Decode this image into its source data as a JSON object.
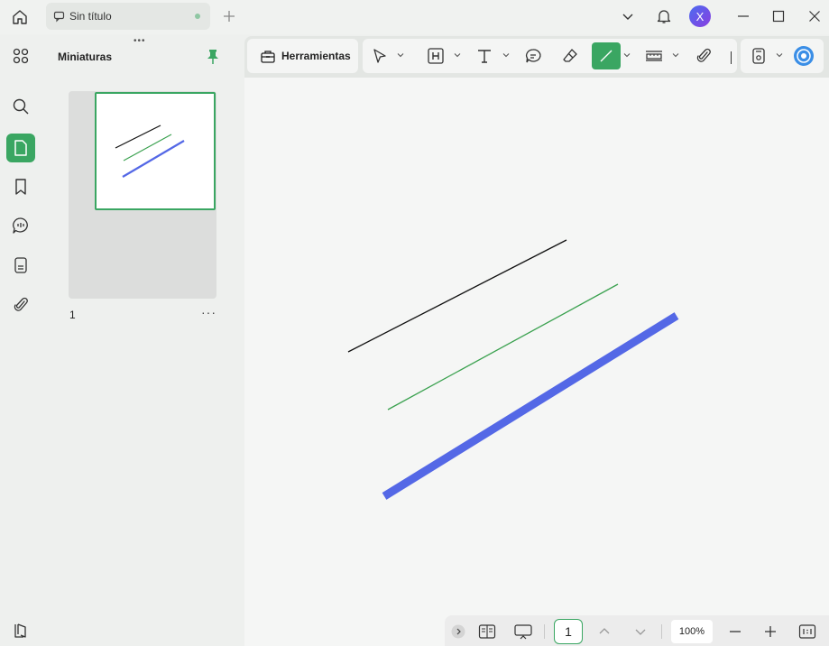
{
  "tab": {
    "title": "Sin título"
  },
  "user": {
    "initial": "X"
  },
  "thumbnails": {
    "title": "Miniaturas",
    "page_number": "1",
    "more": "···"
  },
  "toolbar": {
    "tools_label": "Herramientas"
  },
  "bottom": {
    "page_value": "1",
    "zoom": "100%"
  },
  "colors": {
    "accent": "#3aa662",
    "line_black": "#111111",
    "line_green": "#3aa14f",
    "line_blue": "#5468e6"
  }
}
